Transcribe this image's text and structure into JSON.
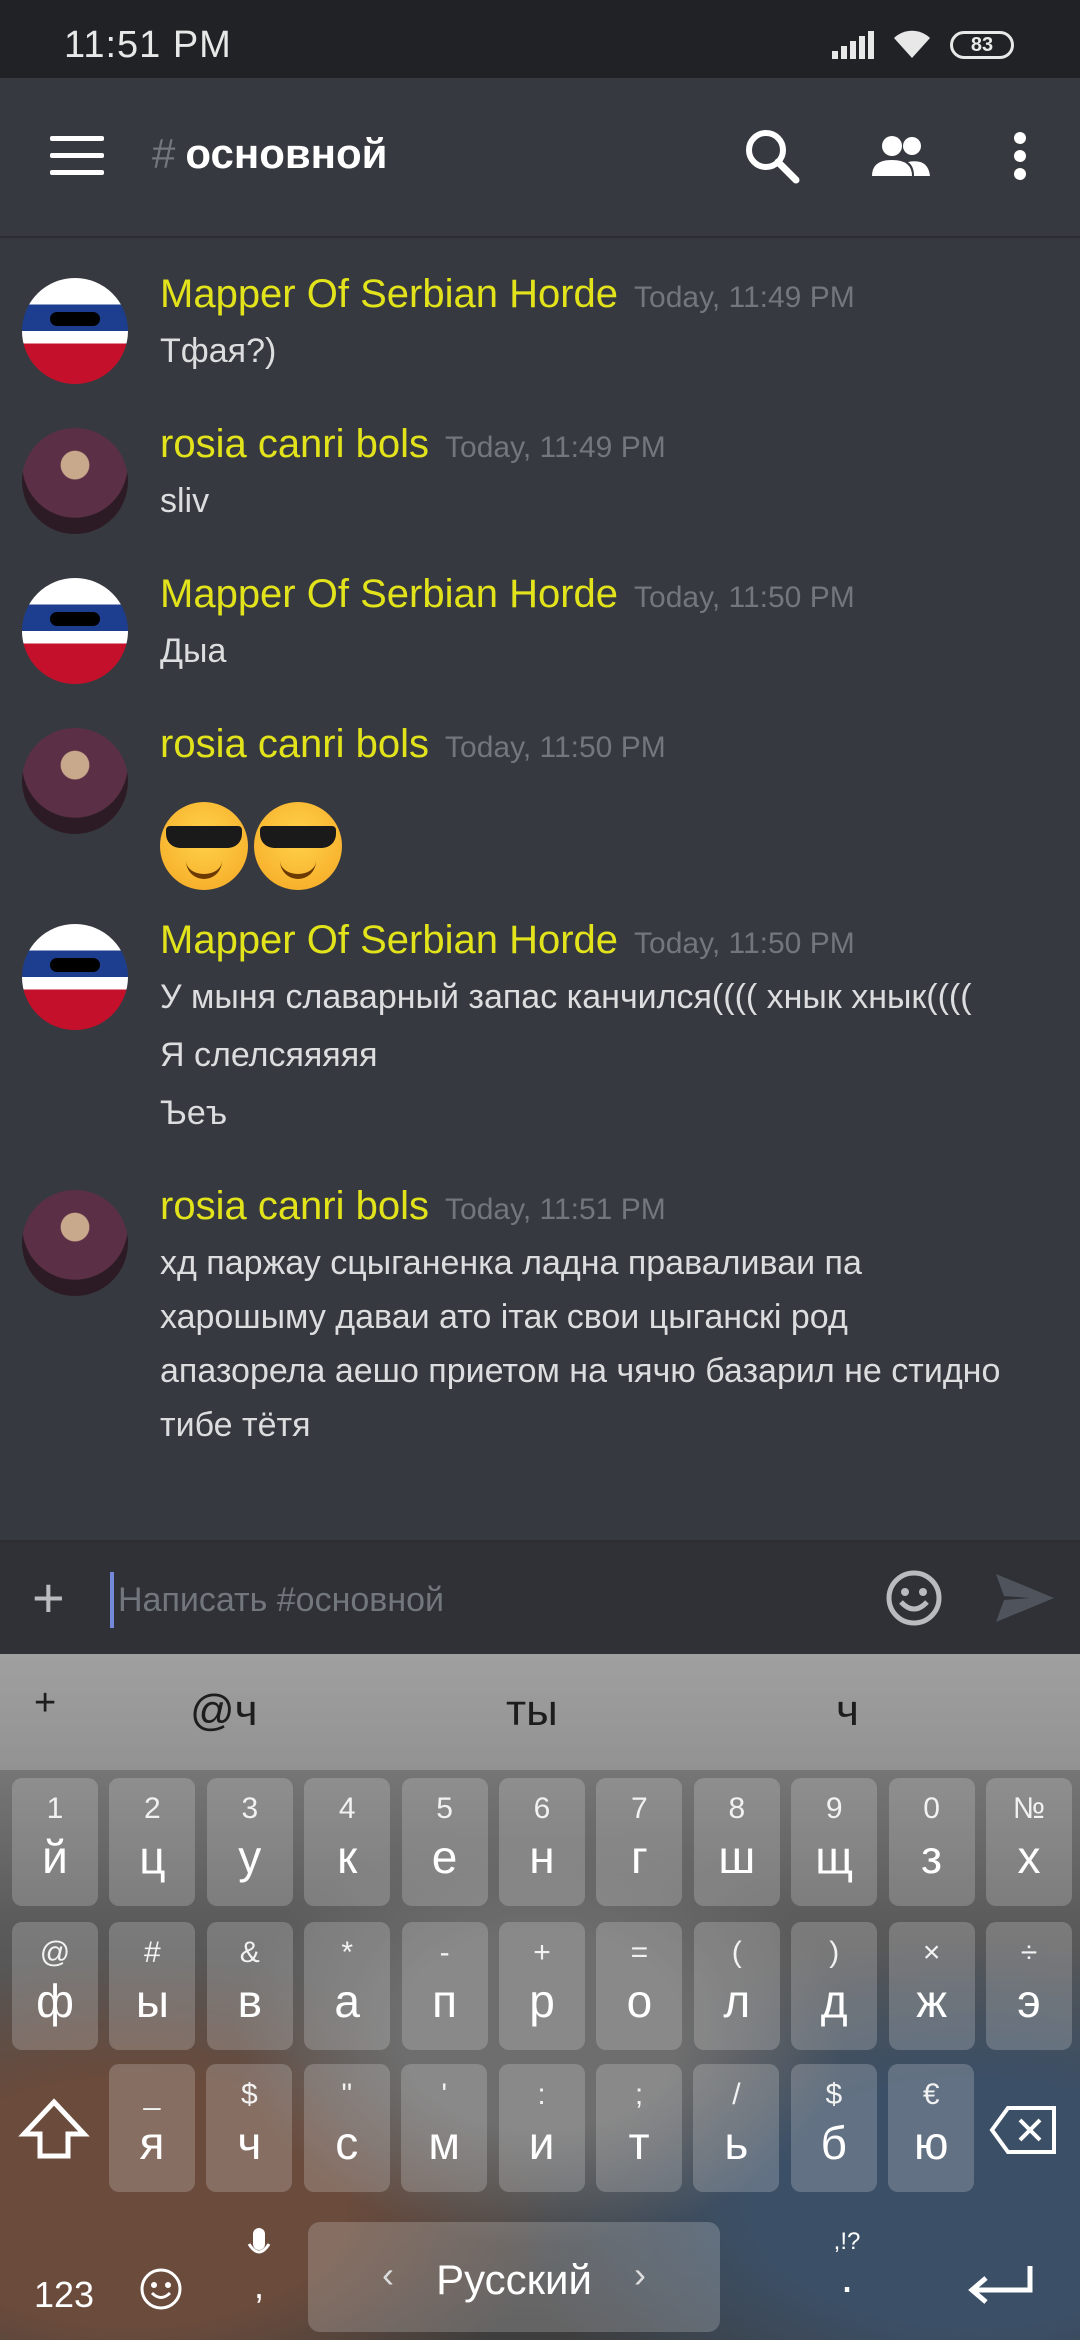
{
  "status": {
    "time": "11:51 PM",
    "battery": "83"
  },
  "header": {
    "hash": "#",
    "channel": "основной"
  },
  "messages": [
    {
      "author": "Mapper Of Serbian Horde",
      "time": "Today, 11:49 PM",
      "lines": [
        "Тфая?)"
      ]
    },
    {
      "author": "rosia canri bols",
      "time": "Today, 11:49 PM",
      "lines": [
        "sliv"
      ]
    },
    {
      "author": "Mapper Of Serbian Horde",
      "time": "Today, 11:50 PM",
      "lines": [
        "Дыа"
      ]
    },
    {
      "author": "rosia canri bols",
      "time": "Today, 11:50 PM",
      "emoji": [
        "smiling-face-with-sunglasses",
        "smiling-face-with-sunglasses"
      ]
    },
    {
      "author": "Mapper Of Serbian Horde",
      "time": "Today, 11:50 PM",
      "lines": [
        "У мыня славарный запас канчился(((( хнык хнык((((",
        "Я слелсяяяяя",
        "Ъеъ"
      ]
    },
    {
      "author": "rosia canri bols",
      "time": "Today, 11:51 PM",
      "lines": [
        "хд паржау сцыганенка ладна праваливаи па",
        "харошыму даваи ато ітак свои цыганскі род",
        "апазорела аешо приетом на чячю базарил не стидно",
        "тибе тётя"
      ]
    }
  ],
  "composer": {
    "placeholder": "Написать #основной",
    "plus": "+"
  },
  "keyboard": {
    "suggestions": [
      "+",
      "@ч",
      "ты",
      "ч"
    ],
    "row1": [
      [
        "1",
        "й"
      ],
      [
        "2",
        "ц"
      ],
      [
        "3",
        "у"
      ],
      [
        "4",
        "к"
      ],
      [
        "5",
        "е"
      ],
      [
        "6",
        "н"
      ],
      [
        "7",
        "г"
      ],
      [
        "8",
        "ш"
      ],
      [
        "9",
        "щ"
      ],
      [
        "0",
        "з"
      ],
      [
        "№",
        "х"
      ]
    ],
    "row2": [
      [
        "@",
        "ф"
      ],
      [
        "#",
        "ы"
      ],
      [
        "&",
        "в"
      ],
      [
        "*",
        "а"
      ],
      [
        "-",
        "п"
      ],
      [
        "+",
        "р"
      ],
      [
        "=",
        "о"
      ],
      [
        "(",
        "л"
      ],
      [
        ")",
        "д"
      ],
      [
        "×",
        "ж"
      ],
      [
        "÷",
        "э"
      ]
    ],
    "row3": [
      [
        "_",
        "я"
      ],
      [
        "$",
        "ч"
      ],
      [
        "\"",
        "с"
      ],
      [
        "'",
        "м"
      ],
      [
        ":",
        "и"
      ],
      [
        ";",
        "т"
      ],
      [
        "/",
        "ь"
      ],
      [
        "$",
        "б"
      ],
      [
        "€",
        "ю"
      ]
    ],
    "bottom": {
      "numbers": "123",
      "comma": ",",
      "language": "Русский",
      "punct": ",!?",
      "period": "."
    }
  }
}
